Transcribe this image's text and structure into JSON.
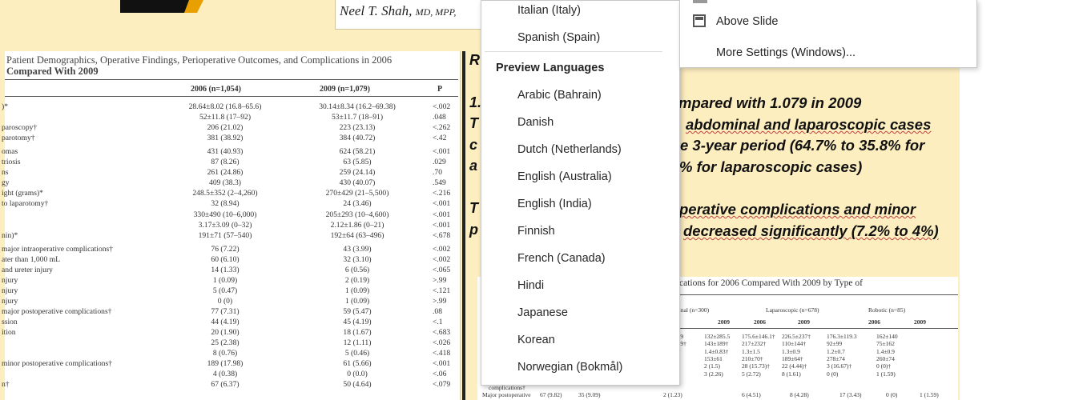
{
  "slide": {
    "author_name": "Neel T. Shah,",
    "author_degrees": "MD, MPP,",
    "body_lines": [
      "mpared with 1.079 in 2009",
      "abdominal and laparoscopic cases",
      "e 3-year period (64.7% to 35.8% for",
      "% for laparoscopic cases)",
      "perative complications and minor",
      "decreased significantly (7.2% to 4%)"
    ],
    "left_peek": [
      "R",
      "1.",
      "T",
      "c",
      "a",
      "T",
      "p"
    ]
  },
  "table1": {
    "title_line1": "Patient Demographics, Operative Findings, Perioperative Outcomes, and Complications in 2006",
    "title_line2": "Compared With 2009",
    "headers": [
      "2006 (n=1,054)",
      "2009 (n=1,079)",
      "P"
    ],
    "rows": [
      [
        ")*",
        "28.64±8.02 (16.8–65.6)",
        "30.14±8.34 (16.2–69.38)",
        "<.002"
      ],
      [
        "",
        "52±11.8 (17–92)",
        "53±11.7 (18–91)",
        ".048"
      ],
      [
        "paroscopy†",
        "206 (21.02)",
        "223 (23.13)",
        "<.262"
      ],
      [
        "parotomy†",
        "381 (38.92)",
        "384 (40.72)",
        "<.42"
      ],
      [
        "omas",
        "431 (40.93)",
        "624 (58.21)",
        "<.001"
      ],
      [
        "triosis",
        "87 (8.26)",
        "63 (5.85)",
        ".029"
      ],
      [
        "ns",
        "261 (24.86)",
        "259 (24.14)",
        ".70"
      ],
      [
        "gy",
        "409 (38.3)",
        "430 (40.07)",
        ".549"
      ],
      [
        "ight (grams)*",
        "248.5±352 (2–4,260)",
        "270±429 (21–5,500)",
        "<.216"
      ],
      [
        "to laparotomy†",
        "32 (8.94)",
        "24 (3.46)",
        "<.001"
      ],
      [
        "",
        "330±490 (10–6,000)",
        "205±293 (10–4,600)",
        "<.001"
      ],
      [
        "",
        "3.17±3.09 (0–32)",
        "2.12±1.86 (0–21)",
        "<.001"
      ],
      [
        "nin)*",
        "191±71 (57–540)",
        "192±64 (63–496)",
        "<.678"
      ],
      [
        "major intraoperative complications†",
        "76 (7.22)",
        "43 (3.99)",
        "<.002"
      ],
      [
        "ater than 1,000 mL",
        "60 (6.10)",
        "32 (3.10)",
        "<.002"
      ],
      [
        "and ureter injury",
        "14 (1.33)",
        "6 (0.56)",
        "<.065"
      ],
      [
        "njury",
        "1 (0.09)",
        "2 (0.19)",
        ">.99"
      ],
      [
        "njury",
        "5 (0.47)",
        "1 (0.09)",
        "<.121"
      ],
      [
        "njury",
        "0 (0)",
        "1 (0.09)",
        ">.99"
      ],
      [
        "major postoperative complications†",
        "77 (7.31)",
        "59 (5.47)",
        ".08"
      ],
      [
        "ssion",
        "44 (4.19)",
        "45 (4.19)",
        "<.1"
      ],
      [
        "ition",
        "20 (1.90)",
        "18 (1.67)",
        "<.683"
      ],
      [
        "",
        "25 (2.38)",
        "12 (1.11)",
        "<.026"
      ],
      [
        "",
        "8 (0.76)",
        "5 (0.46)",
        "<.418"
      ],
      [
        "minor postoperative complications†",
        "189 (17.98)",
        "61 (5.66)",
        "<.001"
      ],
      [
        "",
        "4 (0.38)",
        "0 (0.0)",
        "<.06"
      ],
      [
        "n†",
        "67 (6.37)",
        "50 (4.64)",
        "<.079"
      ]
    ]
  },
  "table2": {
    "title": "cations for 2006 Compared With 2009 by Type of",
    "groups": [
      "ginal (n=300)",
      "Laparoscopic (n=678)",
      "Robotic (n=85)"
    ],
    "years": [
      "2009",
      "2006",
      "2009",
      "2006",
      "2009"
    ],
    "rows": [
      [
        "09.9",
        "132±285.5",
        "175.6±146.1†",
        "226.5±237†",
        "176.3±119.3",
        "162±140"
      ],
      [
        "77.9†",
        "143±189†",
        "217±232†",
        "110±144†",
        "92±99",
        "75±162"
      ],
      [
        ".8†",
        "1.4±0.83†",
        "1.3±1.5",
        "1.3±0.9",
        "1.2±0.7",
        "1.4±0.9"
      ],
      [
        ")",
        "153±61",
        "210±70†",
        "189±64†",
        "278±74",
        "260±74"
      ],
      [
        "2)",
        "2 (1.5)",
        "28 (15.73)†",
        "22 (4.44)†",
        "3 (16.67)†",
        "0 (0)†"
      ],
      [
        "9)",
        "3 (2.26)",
        "5 (2.72)",
        "8 (1.61)",
        "0 (0)",
        "1 (1.59)"
      ]
    ],
    "foot_label1": "complications†",
    "foot_label2": "Major postoperative",
    "foot_values": [
      "67 (9.82)",
      "35 (9.09)",
      "2 (1.23)",
      "6 (4.51)",
      "8 (4.28)",
      "17 (3.43)",
      "0 (0)",
      "1 (1.59)"
    ]
  },
  "language_menu": {
    "top_items": [
      "Italian (Italy)",
      "Spanish (Spain)"
    ],
    "section_header": "Preview Languages",
    "preview_items": [
      "Arabic (Bahrain)",
      "Danish",
      "Dutch (Netherlands)",
      "English (Australia)",
      "English (India)",
      "Finnish",
      "French (Canada)",
      "Hindi",
      "Japanese",
      "Korean",
      "Norwegian (Bokmål)"
    ]
  },
  "settings_menu": {
    "above_slide": "Above Slide",
    "more_settings": "More Settings (Windows)..."
  }
}
